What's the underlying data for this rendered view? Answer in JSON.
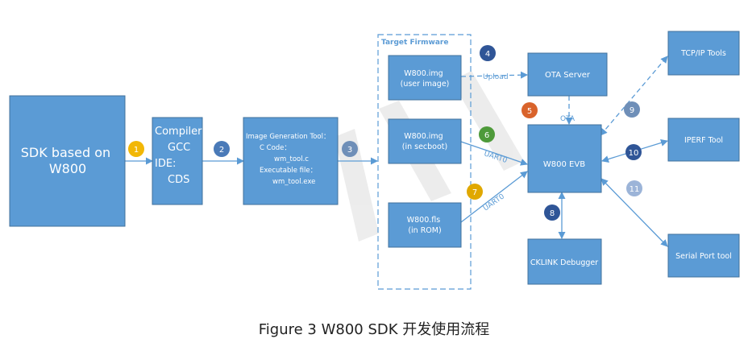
{
  "caption": "Figure 3 W800 SDK 开发使用流程",
  "firmware_group_title": "Target Firmware",
  "colors": {
    "box": "#5b9bd5",
    "badge_yellow": "#f2b705",
    "badge_dark": "#2f5597",
    "badge_orange": "#d9632b",
    "badge_green": "#4e9a3a",
    "badge_slate": "#6f8fb8",
    "badge_light": "#9cb4d8"
  },
  "nodes": {
    "sdk": [
      "SDK based on",
      "W800"
    ],
    "compiler": [
      "Compiler:",
      "GCC",
      "IDE:",
      "CDS"
    ],
    "image_tool": [
      "Image Generation Tool：",
      "C Code：",
      "wm_tool.c",
      "Executable file：",
      "wm_tool.exe"
    ],
    "user_image": [
      "W800.img",
      "(user image)"
    ],
    "secboot_image": [
      "W800.img",
      "(in secboot)"
    ],
    "rom_image": [
      "W800.fls",
      "(in ROM)"
    ],
    "ota_server": [
      "OTA Server"
    ],
    "evb": [
      "W800 EVB"
    ],
    "cklink": [
      "CKLINK Debugger"
    ],
    "tcpip": [
      "TCP/IP Tools"
    ],
    "iperf": [
      "IPERF Tool"
    ],
    "serial": [
      "Serial Port tool"
    ]
  },
  "edge_labels": {
    "upload": "Upload",
    "ota": "OTA",
    "uart_secboot": "UART0",
    "uart_rom": "UART0"
  },
  "steps": [
    "1",
    "2",
    "3",
    "4",
    "5",
    "6",
    "7",
    "8",
    "9",
    "10",
    "11"
  ]
}
